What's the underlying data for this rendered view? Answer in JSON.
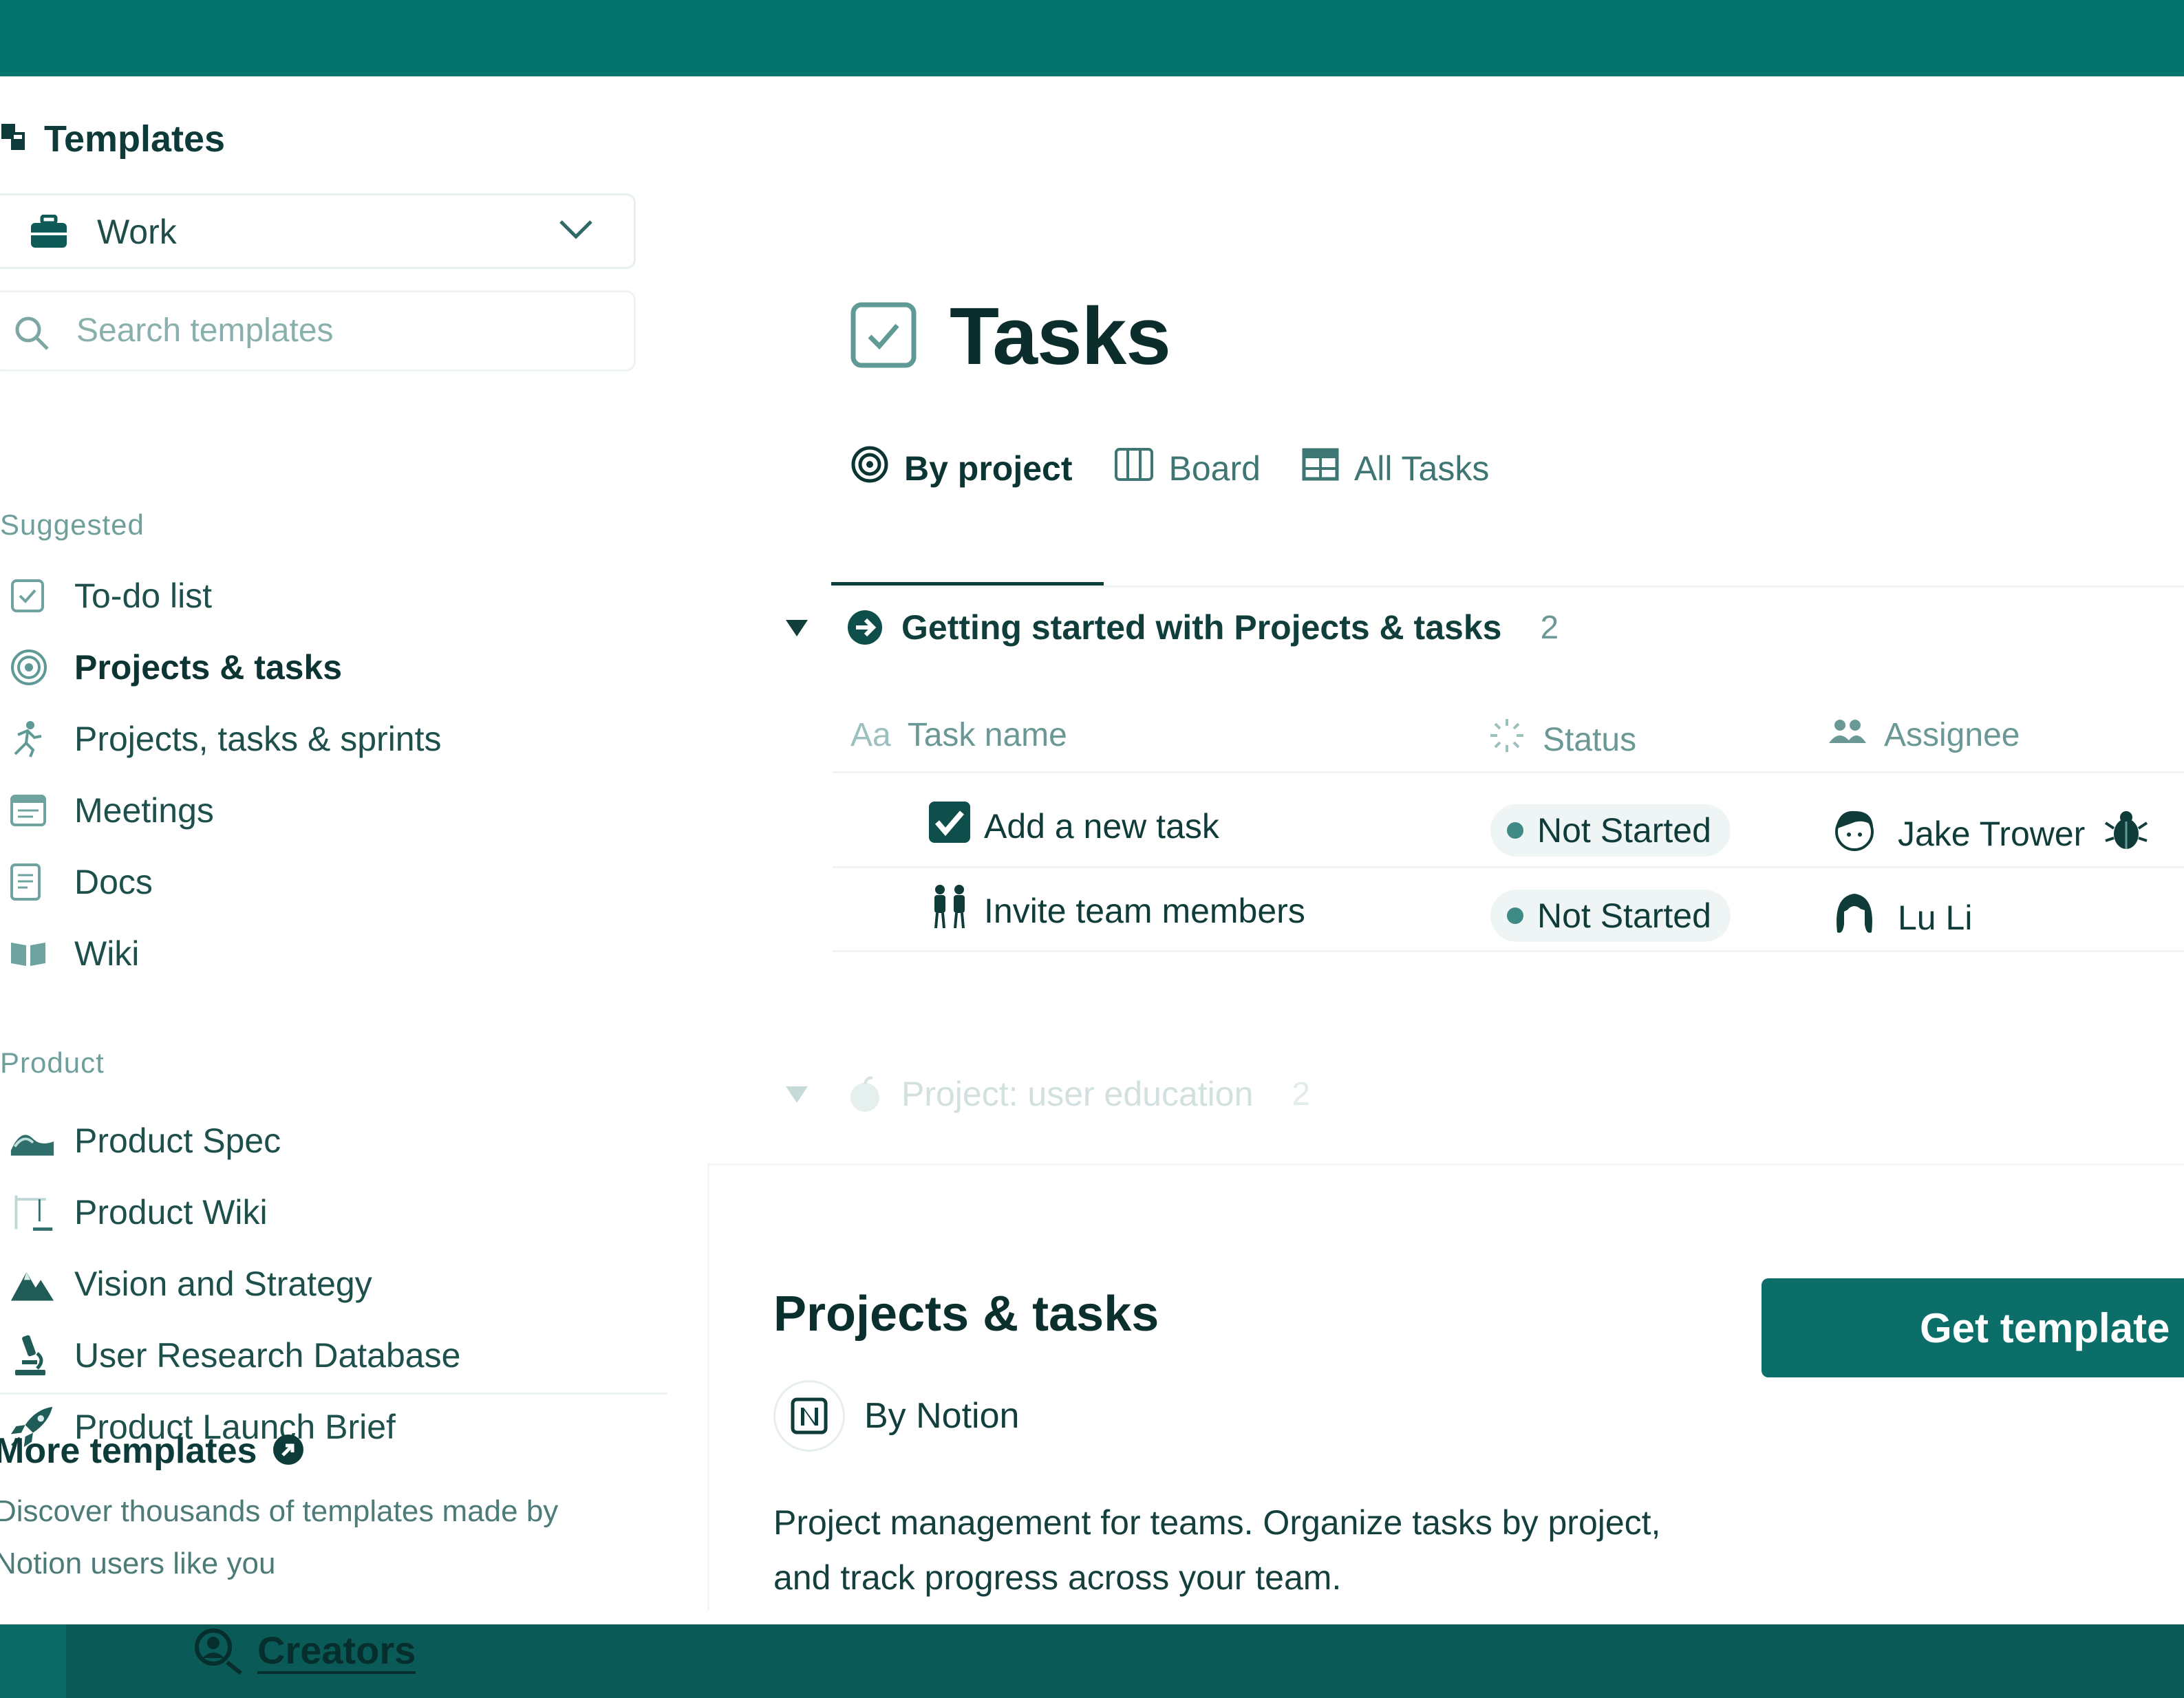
{
  "sidebar": {
    "title": "Templates",
    "category": {
      "value": "Work"
    },
    "search": {
      "placeholder": "Search templates",
      "value": ""
    },
    "suggested": {
      "title": "Suggested",
      "items": [
        {
          "label": "To-do list",
          "icon": "checkbox-icon"
        },
        {
          "label": "Projects & tasks",
          "icon": "target-icon",
          "active": true
        },
        {
          "label": "Projects, tasks & sprints",
          "icon": "runner-icon"
        },
        {
          "label": "Meetings",
          "icon": "meeting-notes-icon"
        },
        {
          "label": "Docs",
          "icon": "document-icon"
        },
        {
          "label": "Wiki",
          "icon": "book-icon"
        }
      ]
    },
    "product": {
      "title": "Product",
      "items": [
        {
          "label": "Product Spec",
          "icon": "wave-icon"
        },
        {
          "label": "Product Wiki",
          "icon": "construction-icon"
        },
        {
          "label": "Vision and Strategy",
          "icon": "mountain-icon"
        },
        {
          "label": "User Research Database",
          "icon": "microscope-icon"
        },
        {
          "label": "Product Launch Brief",
          "icon": "rocket-icon"
        }
      ]
    },
    "more": {
      "title": "More templates",
      "description": "Discover thousands of templates made by Notion users like you"
    }
  },
  "preview": {
    "title": "Tasks",
    "tabs": [
      {
        "label": "By project",
        "icon": "target-icon",
        "active": true
      },
      {
        "label": "Board",
        "icon": "board-icon"
      },
      {
        "label": "All Tasks",
        "icon": "table-icon"
      }
    ],
    "groups": [
      {
        "title": "Getting started with Projects & tasks",
        "count": "2",
        "icon": "arrow-circle-icon"
      },
      {
        "title": "Project: user education",
        "count": "2",
        "icon": "apple-icon"
      }
    ],
    "columns": {
      "name": "Task name",
      "name_prefix": "Aa",
      "status": "Status",
      "assignee": "Assignee"
    },
    "rows": [
      {
        "name": "Add a new task",
        "status": "Not Started",
        "assignee": "Jake Trower"
      },
      {
        "name": "Invite team members",
        "status": "Not Started",
        "assignee": "Lu Li"
      }
    ]
  },
  "info": {
    "title": "Projects & tasks",
    "author": "By Notion",
    "description": "Project management for teams. Organize tasks by project, and track progress across your team.",
    "cta": "Get template"
  },
  "footer": {
    "creators": "Creators"
  },
  "colors": {
    "brand": "#04746f",
    "button": "#0b6e69",
    "text": "#0e3b39",
    "muted": "#6a9894"
  }
}
